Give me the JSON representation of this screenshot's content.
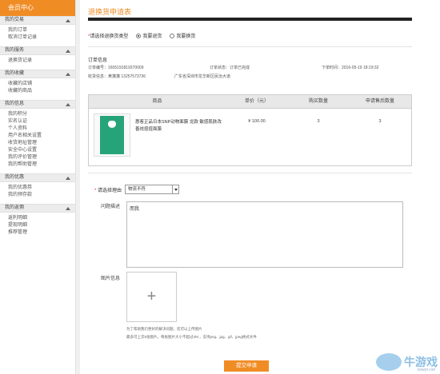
{
  "sidebar": {
    "title": "会员中心",
    "sections": [
      {
        "title": "我的交易",
        "items": [
          "我的订单",
          "取消订单记录"
        ]
      },
      {
        "title": "我的服务",
        "items": [
          "退换货记录"
        ]
      },
      {
        "title": "我的收藏",
        "items": [
          "收藏的店铺",
          "收藏的商品"
        ]
      },
      {
        "title": "我的信息",
        "items": [
          "我的积分",
          "实名认证",
          "个人资料",
          "用户名相关设置",
          "收货地址管理",
          "安全中心设置",
          "我的评价管理",
          "我的帮助管理"
        ]
      },
      {
        "title": "我的优惠",
        "items": [
          "我的优惠券",
          "我的预存款"
        ]
      },
      {
        "title": "我的返佣",
        "items": [
          "返利明细",
          "提现明细",
          "推荐管理"
        ]
      }
    ]
  },
  "page": {
    "title": "退换货申请表",
    "type_label": "请选择退换货类型",
    "option_return": "我要退货",
    "option_exchange": "我要换货",
    "order_header": "订单信息",
    "order_no": "订单编号：1605191819370009",
    "order_status": "订单状态：订单已完成",
    "order_time": "下单时间：2016-05-19 18:19:32",
    "receiver": "收货信息：黄藩藩 13257573736",
    "address": "广东省深圳市龙华新区民治大道"
  },
  "table": {
    "headers": [
      "商品",
      "单价（元）",
      "购买数量",
      "申请售后数量"
    ],
    "row": {
      "name": "惠客正品日本SNP动物面膜 龙款 敏感肌肤改善祛痘痘面膜",
      "price": "¥ 100.00",
      "qty": "3",
      "apply_qty": "3"
    }
  },
  "form": {
    "reason_label": "请选择理由",
    "reason_value": "物流不符",
    "desc_label": "问题描述",
    "desc_value": "而我",
    "image_label": "图片信息",
    "upload_glyph": "+",
    "hint1": "为了帮助我们更好的解决问题，您可以上传图片",
    "hint2": "最多可上次5张图片，每张图片大小不超过2M ，支持png、jpg、gif、jpeg格式文件",
    "submit": "提交申请"
  },
  "watermark": {
    "text": "牛游戏",
    "url": "newyx.net"
  }
}
